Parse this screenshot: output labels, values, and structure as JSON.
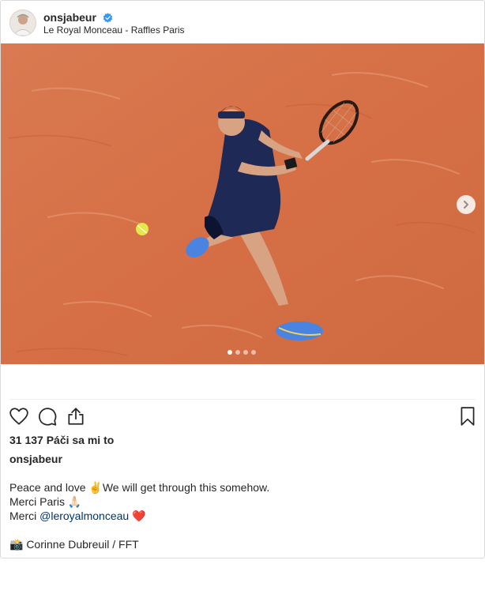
{
  "post": {
    "username": "onsjabeur",
    "location": "Le Royal Monceau - Raffles Paris",
    "likes": "31 137 Páči sa mi to",
    "caption_author": "onsjabeur",
    "caption_line1": "Peace and love ✌️We will get through this somehow.",
    "caption_line2": "Merci Paris 🙏🏻",
    "caption_line3_prefix": "Merci ",
    "caption_mention": "@leroyalmonceau",
    "caption_line3_suffix": " ❤️",
    "caption_credit": "📸 Corinne Dubreuil / FFT"
  },
  "carousel": {
    "slide_count": 4,
    "active_index": 0
  },
  "colors": {
    "accent": "#3897f0",
    "mention": "#003569",
    "clay": "#d9744a"
  },
  "icons": [
    "verified-badge-icon",
    "chevron-right-icon",
    "heart-icon",
    "comment-icon",
    "share-icon",
    "bookmark-icon"
  ]
}
